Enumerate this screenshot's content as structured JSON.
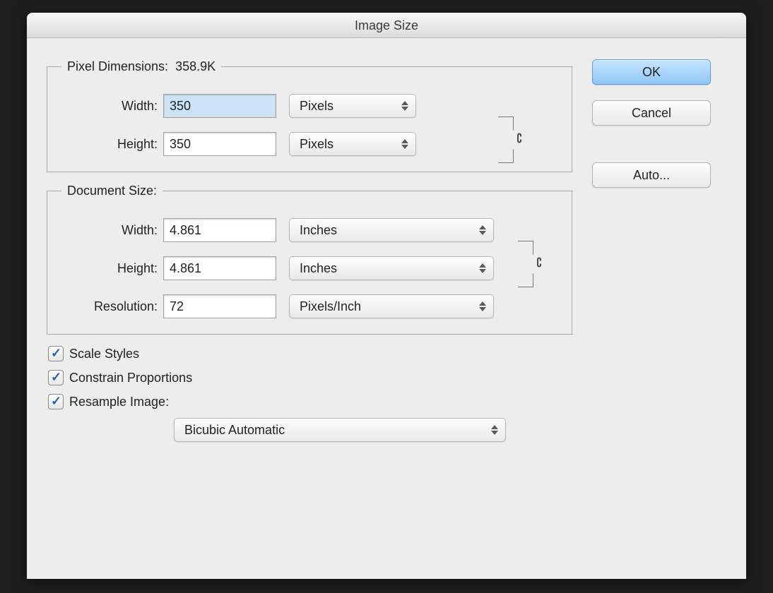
{
  "dialog_title": "Image Size",
  "pixel_dimensions": {
    "legend_label": "Pixel Dimensions:",
    "size_readout": "358.9K",
    "width_label": "Width:",
    "width_value": "350",
    "width_unit": "Pixels",
    "height_label": "Height:",
    "height_value": "350",
    "height_unit": "Pixels"
  },
  "document_size": {
    "legend_label": "Document Size:",
    "width_label": "Width:",
    "width_value": "4.861",
    "width_unit": "Inches",
    "height_label": "Height:",
    "height_value": "4.861",
    "height_unit": "Inches",
    "resolution_label": "Resolution:",
    "resolution_value": "72",
    "resolution_unit": "Pixels/Inch"
  },
  "checkboxes": {
    "scale_styles": "Scale Styles",
    "constrain_proportions": "Constrain Proportions",
    "resample_image": "Resample Image:"
  },
  "resample_method": "Bicubic Automatic",
  "buttons": {
    "ok": "OK",
    "cancel": "Cancel",
    "auto": "Auto..."
  }
}
